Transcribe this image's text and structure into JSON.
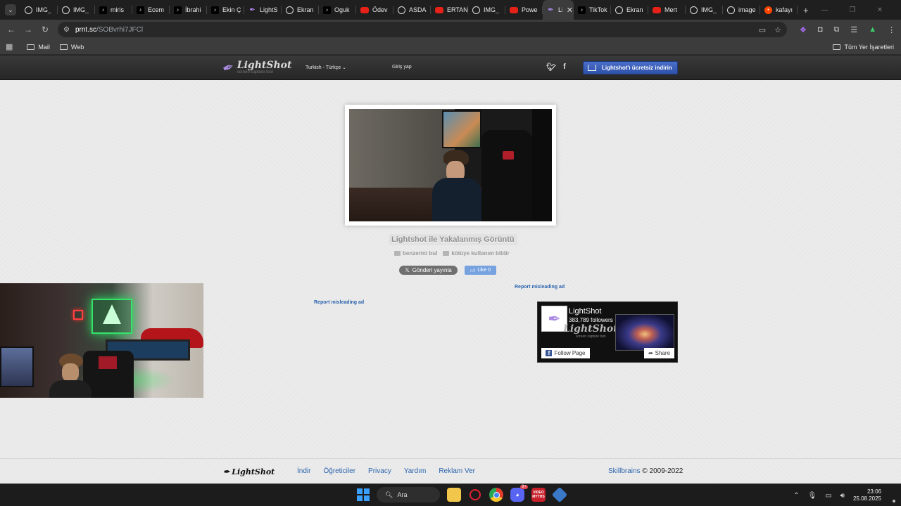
{
  "browser": {
    "tabs": [
      {
        "label": "IMG_",
        "icon": "globe-icon"
      },
      {
        "label": "IMG_",
        "icon": "globe-icon"
      },
      {
        "label": "miris",
        "icon": "tiktok-icon"
      },
      {
        "label": "Ecem",
        "icon": "tiktok-icon"
      },
      {
        "label": "İbrahi",
        "icon": "tiktok-icon"
      },
      {
        "label": "Ekin Ç",
        "icon": "tiktok-icon"
      },
      {
        "label": "LightS",
        "icon": "lightshot-icon"
      },
      {
        "label": "Ekran",
        "icon": "globe-icon"
      },
      {
        "label": "Oguk",
        "icon": "tiktok-icon"
      },
      {
        "label": "Ödev",
        "icon": "youtube-icon"
      },
      {
        "label": "ASDA",
        "icon": "globe-icon"
      },
      {
        "label": "ERTAN",
        "icon": "youtube-icon"
      },
      {
        "label": "IMG_",
        "icon": "globe-icon"
      },
      {
        "label": "Powe",
        "icon": "youtube-icon"
      },
      {
        "label": "Li",
        "icon": "lightshot-icon",
        "active": true
      },
      {
        "label": "TikTok",
        "icon": "tiktok-icon"
      },
      {
        "label": "Ekran",
        "icon": "globe-icon"
      },
      {
        "label": "Mert",
        "icon": "youtube-icon"
      },
      {
        "label": "IMG_",
        "icon": "globe-icon"
      },
      {
        "label": "image",
        "icon": "globe-icon"
      },
      {
        "label": "kafayı",
        "icon": "reddit-icon"
      }
    ],
    "url_host": "prnt.sc",
    "url_path": "/SOBvrhi7JFCl",
    "bookmarks": [
      {
        "label": "Mail"
      },
      {
        "label": "Web"
      }
    ],
    "all_bookmarks_label": "Tüm Yer İşaretleri"
  },
  "site": {
    "logo_text": "LightShot",
    "logo_sub": "screen capture tool",
    "language": "Turkish - Türkçe",
    "login": "Giriş yap",
    "download_button": "Lightshot'ı ücretsiz indirin",
    "caption": "Lightshot ile Yakalanmış Görüntü",
    "find_similar": "benzerini bul",
    "report_abuse": "kötüye kullanım bildir",
    "tweet_button": "Gönderi yayınla",
    "like_button": "Like 0",
    "report_ad_1": "Report misleading ad",
    "report_ad_2": "Report misleading ad"
  },
  "facebook_widget": {
    "page_name": "LightShot",
    "followers": "383,789 followers",
    "watermark": "LightShot",
    "watermark_sub": "screen capture tool",
    "follow_button": "Follow Page",
    "share_button": "Share"
  },
  "footer": {
    "logo": "LightShot",
    "links": [
      "İndir",
      "Öğreticiler",
      "Privacy",
      "Yardım",
      "Reklam Ver"
    ],
    "company": "Skillbrains",
    "copyright": "© 2009-2022"
  },
  "taskbar": {
    "search_label": "Ara",
    "discord_badge": "9+",
    "news_label": "VIDEO MYTHS",
    "time": "23:06",
    "date": "25.08.2025"
  },
  "colors": {
    "accent_blue": "#2a64ae",
    "download_button": "#3b5fb8",
    "page_background": "#ececec"
  }
}
